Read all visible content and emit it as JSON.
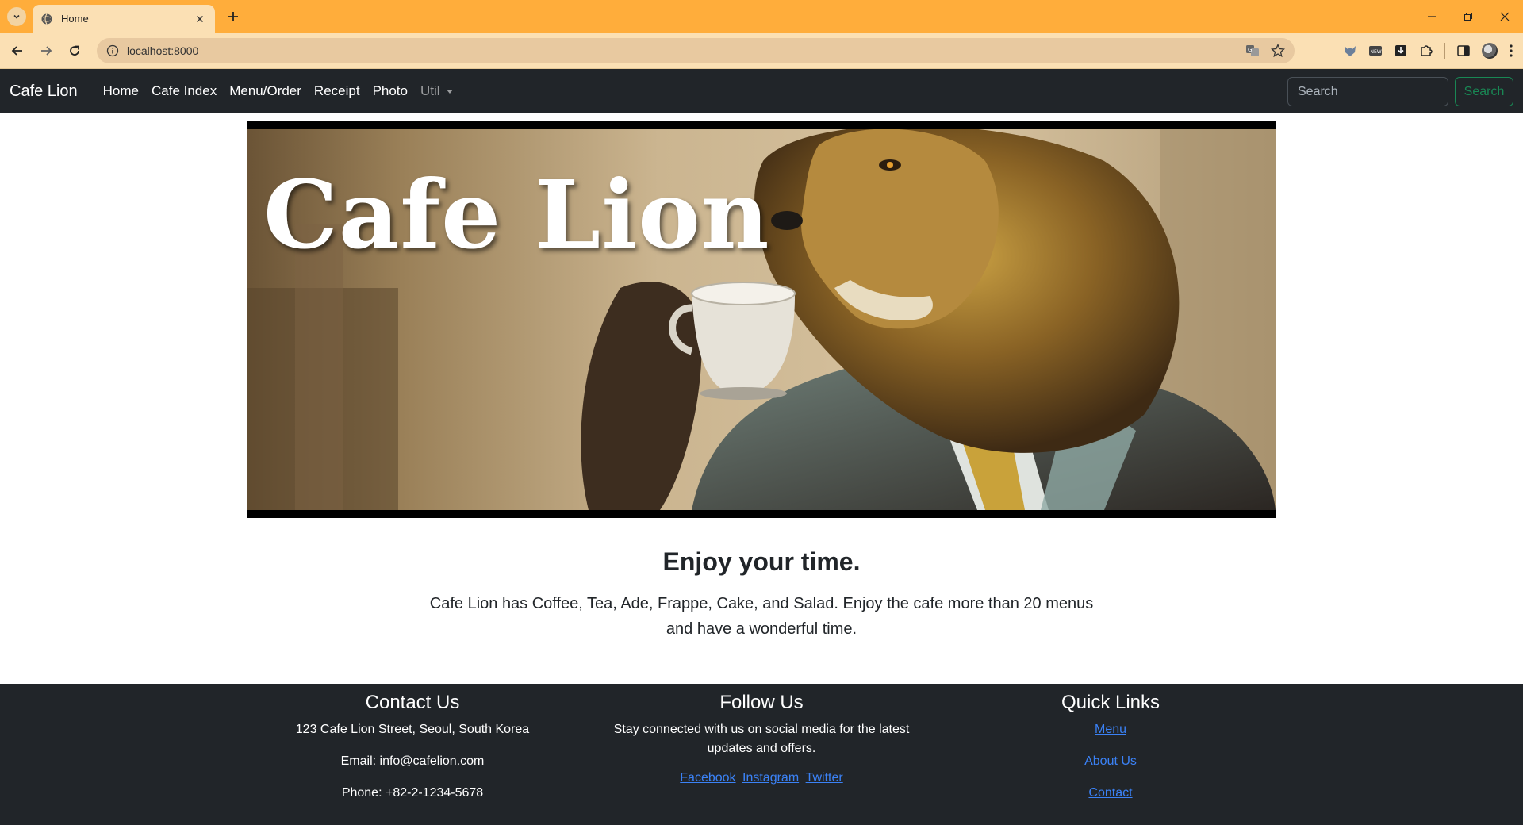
{
  "browser": {
    "tab_title": "Home",
    "url": "localhost:8000"
  },
  "navbar": {
    "brand": "Cafe Lion",
    "links": [
      "Home",
      "Cafe Index",
      "Menu/Order",
      "Receipt",
      "Photo"
    ],
    "util_label": "Util",
    "search_placeholder": "Search",
    "search_button": "Search"
  },
  "hero": {
    "title": "Cafe Lion"
  },
  "content": {
    "heading": "Enjoy your time.",
    "description": "Cafe Lion has Coffee, Tea, Ade, Frappe, Cake, and Salad. Enjoy the cafe more than 20 menus and have a wonderful time."
  },
  "footer": {
    "contact": {
      "title": "Contact Us",
      "address": "123 Cafe Lion Street, Seoul, South Korea",
      "email": "Email: info@cafelion.com",
      "phone": "Phone: +82-2-1234-5678"
    },
    "follow": {
      "title": "Follow Us",
      "text": "Stay connected with us on social media for the latest updates and offers.",
      "links": [
        "Facebook",
        "Instagram",
        "Twitter"
      ]
    },
    "quick": {
      "title": "Quick Links",
      "links": [
        "Menu",
        "About Us",
        "Contact"
      ]
    }
  },
  "colors": {
    "tabbar": "#FFAD3B",
    "toolbar": "#FBE0B4",
    "navbar": "#212529",
    "search_button": "#198754",
    "link": "#3B82F6"
  }
}
